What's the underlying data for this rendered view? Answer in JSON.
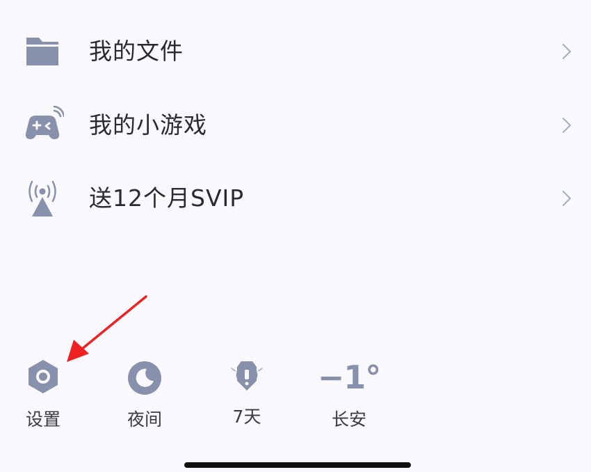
{
  "menu": {
    "items": [
      {
        "label": "我的文件",
        "icon": "folder-icon"
      },
      {
        "label": "我的小游戏",
        "icon": "gamepad-icon"
      },
      {
        "label": "送12个月SVIP",
        "icon": "broadcast-tower-icon"
      }
    ]
  },
  "bottom_bar": {
    "items": [
      {
        "label": "设置",
        "icon": "hexagon-gear-icon"
      },
      {
        "label": "夜间",
        "icon": "moon-icon"
      },
      {
        "label": "7天",
        "icon": "winged-badge-icon"
      },
      {
        "label": "长安",
        "value": "−1°",
        "icon": "temperature"
      }
    ]
  },
  "colors": {
    "background": "#f9f8fc",
    "icon": "#8791ab",
    "text": "#2a2a30",
    "arrow": "#ee2222"
  }
}
